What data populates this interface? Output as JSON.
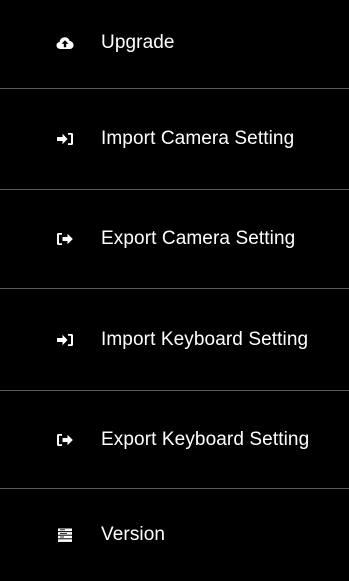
{
  "menu": {
    "items": [
      {
        "label": "Upgrade",
        "icon": "cloud-upload-icon"
      },
      {
        "label": "Import Camera Setting",
        "icon": "sign-in-icon"
      },
      {
        "label": "Export Camera Setting",
        "icon": "sign-out-icon"
      },
      {
        "label": "Import Keyboard Setting",
        "icon": "sign-in-icon"
      },
      {
        "label": "Export Keyboard Setting",
        "icon": "sign-out-icon"
      },
      {
        "label": "Version",
        "icon": "list-icon"
      }
    ]
  },
  "colors": {
    "background": "#000000",
    "text": "#ffffff",
    "divider": "#5a5a5a"
  }
}
